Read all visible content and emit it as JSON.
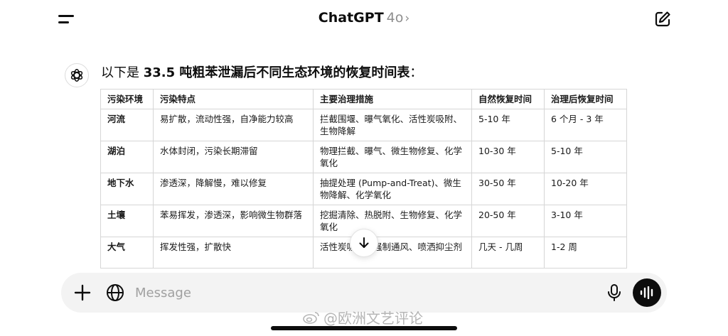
{
  "header": {
    "app_name": "ChatGPT",
    "model": "4o",
    "chevron": "›",
    "menu_icon": "menu-icon",
    "edit_icon": "new-chat-icon"
  },
  "message": {
    "avatar_icon": "openai-logo-icon",
    "intro_prefix": "以下是 ",
    "intro_bold": "33.5 吨粗苯泄漏后不同生态环境的恢复时间表",
    "intro_suffix": "："
  },
  "table": {
    "headers": [
      "污染环境",
      "污染特点",
      "主要治理措施",
      "自然恢复时间",
      "治理后恢复时间"
    ],
    "rows": [
      [
        "河流",
        "易扩散，流动性强，自净能力较高",
        "拦截围堰、曝气氧化、活性炭吸附、生物降解",
        "5-10 年",
        "6 个月 - 3 年"
      ],
      [
        "湖泊",
        "水体封闭，污染长期滞留",
        "物理拦截、曝气、微生物修复、化学氧化",
        "10-30 年",
        "5-10 年"
      ],
      [
        "地下水",
        "渗透深，降解慢，难以修复",
        "抽提处理 (Pump-and-Treat)、微生物降解、化学氧化",
        "30-50 年",
        "10-20 年"
      ],
      [
        "土壤",
        "苯易挥发，渗透深，影响微生物群落",
        "挖掘清除、热脱附、生物修复、化学氧化",
        "20-50 年",
        "3-10 年"
      ],
      [
        "大气",
        "挥发性强，扩散快",
        "活性炭吸附、强制通风、喷洒抑尘剂",
        "几天 - 几周",
        "1-2 周"
      ]
    ]
  },
  "scroll_button": {
    "icon": "arrow-down-icon"
  },
  "composer": {
    "placeholder": "Message",
    "plus_icon": "plus-icon",
    "globe_icon": "globe-icon",
    "mic_icon": "mic-icon",
    "voice_icon": "voice-mode-icon"
  },
  "watermark": {
    "text": "@欧洲文艺评论",
    "icon": "weibo-logo-icon"
  }
}
